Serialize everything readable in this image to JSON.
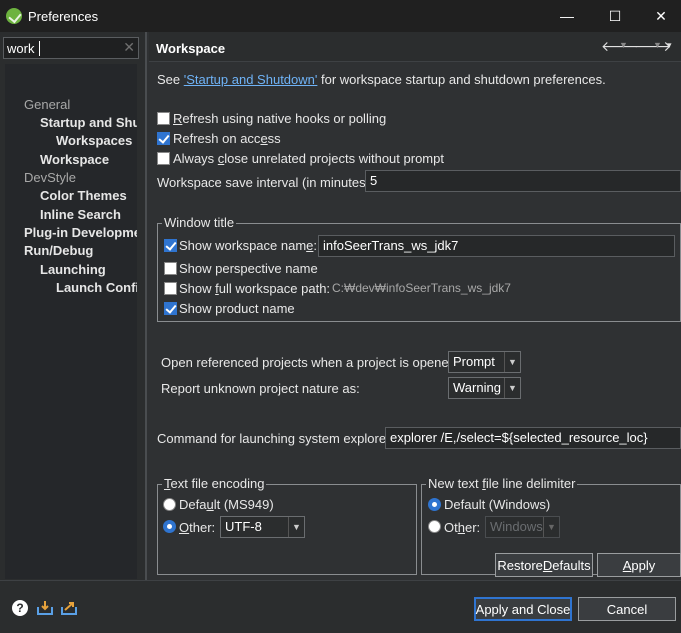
{
  "window": {
    "title": "Preferences",
    "minimize": "—",
    "maximize": "☐",
    "close": "✕"
  },
  "filter": {
    "value": "work"
  },
  "tree": [
    {
      "label": "General",
      "kind": "cat"
    },
    {
      "label": "Startup and Shutdown",
      "kind": "bold"
    },
    {
      "label": "Workspaces",
      "kind": "bold"
    },
    {
      "label": "Workspace",
      "kind": "bold"
    },
    {
      "label": "DevStyle",
      "kind": "cat"
    },
    {
      "label": "Color Themes",
      "kind": "bold"
    },
    {
      "label": "Inline Search",
      "kind": "bold"
    },
    {
      "label": "Plug-in Development",
      "kind": "bold"
    },
    {
      "label": "Run/Debug",
      "kind": "bold"
    },
    {
      "label": "Launching",
      "kind": "bold"
    },
    {
      "label": "Launch Configurations",
      "kind": "bold"
    }
  ],
  "page": {
    "title": "Workspace",
    "intro_prefix": "See ",
    "intro_link": "'Startup and Shutdown'",
    "intro_suffix": " for workspace startup and shutdown preferences."
  },
  "options": {
    "refresh_native": {
      "label_pre": "",
      "mnemonic": "R",
      "label_post": "efresh using native hooks or polling",
      "checked": false
    },
    "refresh_access": {
      "label_pre": "Refresh on acc",
      "mnemonic": "e",
      "label_post": "ss",
      "checked": true
    },
    "close_unrelated": {
      "label_pre": "Always ",
      "mnemonic": "c",
      "label_post": "lose unrelated projects without prompt",
      "checked": false
    },
    "save_interval_label": "Workspace save interval (in minutes):",
    "save_interval_value": "5"
  },
  "window_title": {
    "group_label": "Window title",
    "show_ws_name": {
      "label_pre": "Show workspace nam",
      "mnemonic": "e",
      "label_post": ":",
      "checked": true,
      "value": "infoSeerTrans_ws_jdk7"
    },
    "show_perspective": {
      "label": "Show perspective name",
      "checked": false
    },
    "show_full_path": {
      "label_pre": "Show ",
      "mnemonic": "f",
      "label_post": "ull workspace path:",
      "checked": false,
      "value": "C:₩dev₩infoSeerTrans_ws_jdk7"
    },
    "show_product": {
      "label": "Show product name",
      "checked": true
    }
  },
  "projects": {
    "open_ref_label": "Open referenced projects when a project is opened:",
    "open_ref_value": "Prompt",
    "unknown_nature_label": "Report unknown project nature as:",
    "unknown_nature_value": "Warning"
  },
  "explorer": {
    "label": "Command for launching system explorer:",
    "value": "explorer /E,/select=${selected_resource_loc}"
  },
  "encoding": {
    "group_pre": "",
    "group_mnemonic": "T",
    "group_post": "ext file encoding",
    "default_pre": "Defa",
    "default_mnemonic": "u",
    "default_post": "lt (MS949)",
    "other_mnemonic": "O",
    "other_post": "ther:",
    "other_value": "UTF-8",
    "selected": "other"
  },
  "delimiter": {
    "group_pre": "New text ",
    "group_mnemonic": "f",
    "group_post": "ile line delimiter",
    "default_label": "Default (Windows)",
    "other_pre": "Ot",
    "other_mnemonic": "h",
    "other_post": "er:",
    "other_value": "Windows",
    "selected": "default"
  },
  "buttons": {
    "restore_pre": "Restore ",
    "restore_mnemonic": "D",
    "restore_post": "efaults",
    "apply_pre": "",
    "apply_mnemonic": "A",
    "apply_post": "pply",
    "apply_close": "Apply and Close",
    "cancel": "Cancel"
  },
  "icons": {
    "app": "spring-leaf-icon",
    "back": "arrow-left-icon",
    "forward": "arrow-right-icon",
    "help": "help-icon",
    "import": "import-icon",
    "export": "export-icon"
  },
  "colors": {
    "accent": "#2f74d0",
    "link": "#6fb3f7",
    "spring": "#6db33f"
  }
}
